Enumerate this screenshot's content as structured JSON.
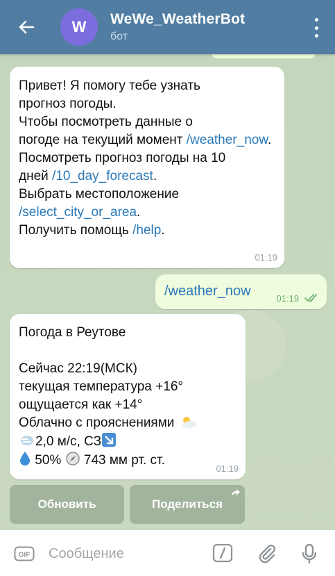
{
  "header": {
    "avatar_letter": "W",
    "title": "WeWe_WeatherBot",
    "subtitle": "бот"
  },
  "messages": [
    {
      "direction": "incoming",
      "time": "01:19",
      "lines": [
        "Привет! Я помогу тебе узнать",
        "прогноз погоды.",
        "Чтобы посмотреть данные о",
        "погоде на текущий момент",
        "/weather_now",
        "Посмотреть прогноз погоды на 10",
        "дней",
        "/10_day_forecast",
        "Выбрать местоположение",
        "/select_city_or_area",
        "Получить помощь",
        "/help"
      ]
    },
    {
      "direction": "outgoing",
      "time": "01:19",
      "text": "/weather_now"
    },
    {
      "direction": "incoming",
      "time": "01:19",
      "lines": [
        "Погода в Реутове",
        "Сейчас 22:19(МСК)",
        "текущая температура +16°",
        "ощущается как +14°",
        "Облачно с прояснениями",
        "2,0 м/с, СЗ",
        "50%",
        "743 мм рт. ст."
      ]
    }
  ],
  "keyboard": {
    "refresh_label": "Обновить",
    "share_label": "Поделиться"
  },
  "composer": {
    "placeholder": "Сообщение",
    "gif_label": "GIF"
  },
  "colors": {
    "header": "#517da2",
    "link": "#2a79b8",
    "outgoing_bubble": "#effdde",
    "avatar": "#7b6dde"
  }
}
